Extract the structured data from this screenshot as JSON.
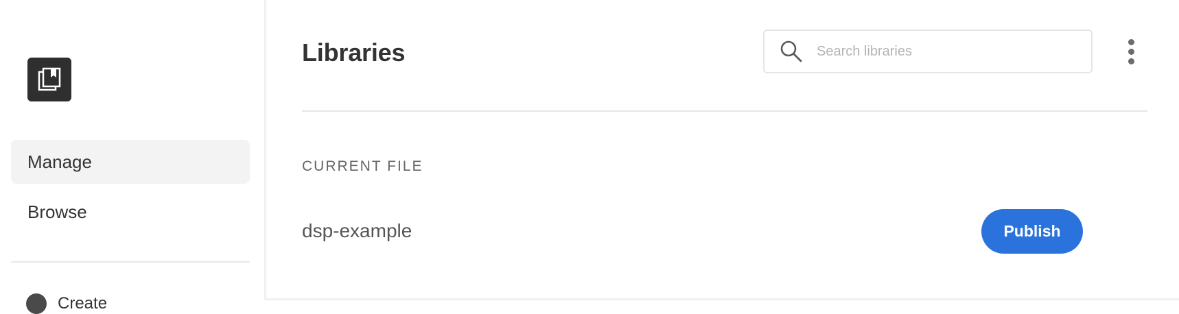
{
  "window": {
    "close_color": "#ee6a5f"
  },
  "sidebar": {
    "logo_icon": "library-book-icon",
    "items": [
      {
        "label": "Manage",
        "active": true
      },
      {
        "label": "Browse",
        "active": false
      }
    ],
    "partial_item": {
      "label": "Create",
      "icon": "info-circle-icon"
    }
  },
  "header": {
    "title": "Libraries",
    "search": {
      "placeholder": "Search libraries",
      "value": ""
    },
    "more_icon": "more-vertical-icon"
  },
  "content": {
    "section_label": "CURRENT FILE",
    "file": {
      "name": "dsp-example",
      "action_label": "Publish"
    }
  },
  "colors": {
    "accent": "#2b73dc",
    "logo_bg": "#2f2f2f",
    "active_nav_bg": "#f3f3f3"
  }
}
